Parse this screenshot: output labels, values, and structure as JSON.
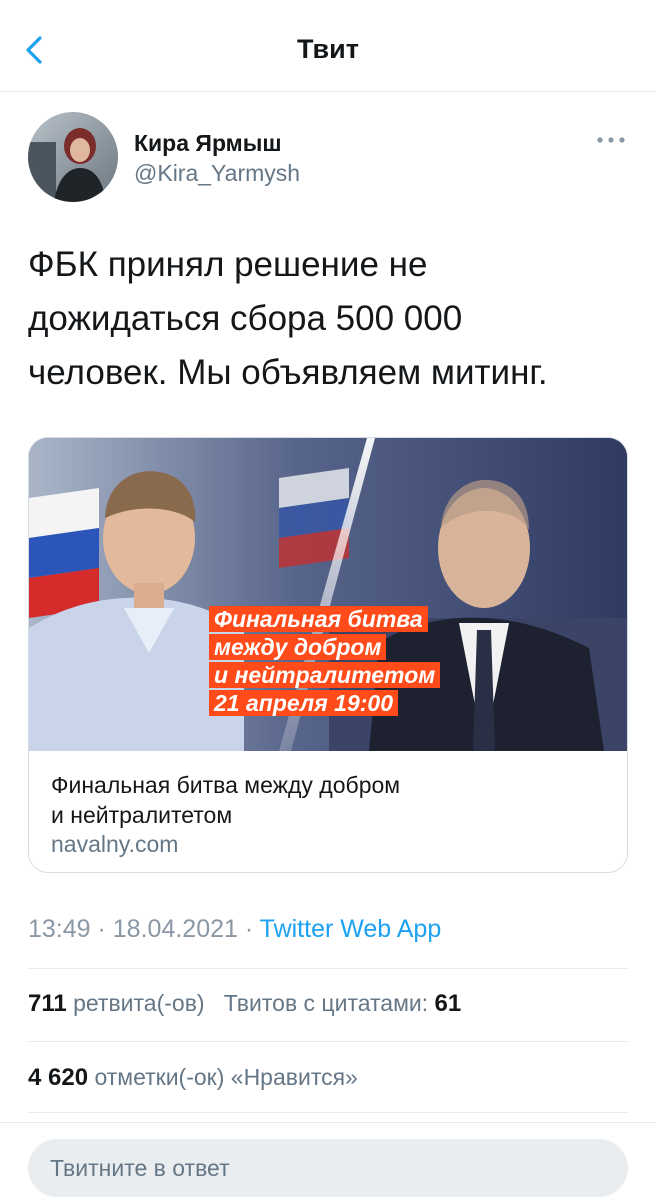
{
  "header": {
    "title": "Твит"
  },
  "author": {
    "name": "Кира Ярмыш",
    "handle": "@Kira_Yarmysh"
  },
  "tweet": {
    "lines": [
      "ФБК принял решение не",
      "дожидаться сбора 500 000",
      "человек. Мы объявляем митинг."
    ]
  },
  "card": {
    "banner_lines": [
      "Финальная битва",
      "между добром",
      "и нейтралитетом",
      "21 апреля 19:00"
    ],
    "title_lines": [
      "Финальная битва между добром",
      "и нейтралитетом"
    ],
    "domain": "navalny.com"
  },
  "meta": {
    "time": "13:49",
    "sep1": " · ",
    "date": "18.04.2021",
    "sep2": " · ",
    "app": "Twitter Web App"
  },
  "stats": {
    "retweets_count": "711",
    "retweets_label": "ретвита(-ов)",
    "quotes_label": "Твитов с цитатами:",
    "quotes_count": "61",
    "likes_count": "4 620",
    "likes_label": "отметки(-ок) «Нравится»"
  },
  "reply": {
    "placeholder": "Твитните в ответ"
  },
  "colors": {
    "accent": "#1da1f2",
    "banner": "#ff4a1a",
    "secondary_text": "#657786"
  },
  "icons": {
    "back": "chevron-left-icon",
    "more": "more-dots-icon"
  }
}
